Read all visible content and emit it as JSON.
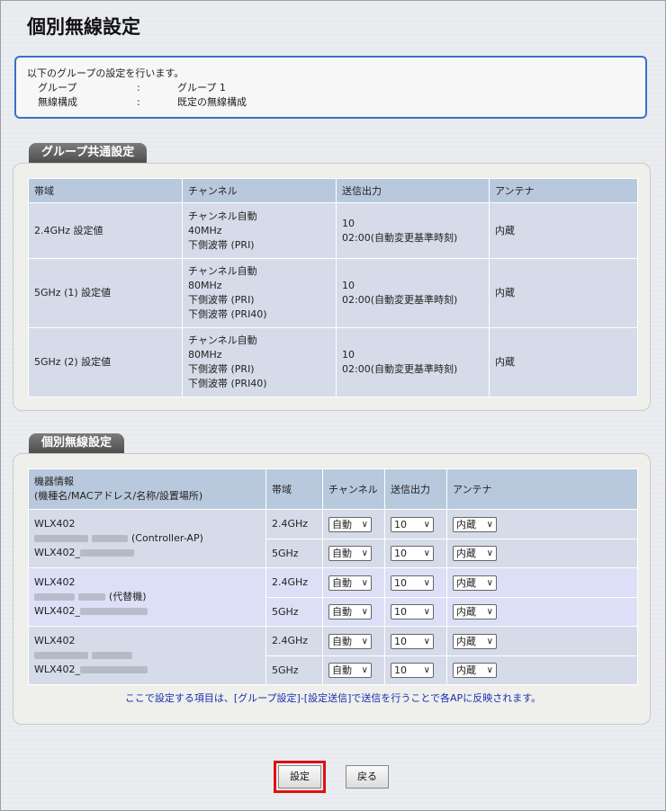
{
  "page": {
    "title": "個別無線設定",
    "info": {
      "intro": "以下のグループの設定を行います。",
      "rows": [
        {
          "key": "グループ",
          "colon": ":",
          "value": "グループ 1"
        },
        {
          "key": "無線構成",
          "colon": ":",
          "value": "既定の無線構成"
        }
      ]
    }
  },
  "common": {
    "tab_label": "グループ共通設定",
    "headers": [
      "帯域",
      "チャンネル",
      "送信出力",
      "アンテナ"
    ],
    "rows": [
      {
        "band": "2.4GHz 設定値",
        "channel": [
          "チャンネル自動",
          "40MHz",
          "下側波帯 (PRI)"
        ],
        "power": [
          "10",
          "02:00(自動変更基準時刻)"
        ],
        "antenna": "内蔵"
      },
      {
        "band": "5GHz (1) 設定値",
        "channel": [
          "チャンネル自動",
          "80MHz",
          "下側波帯 (PRI)",
          "下側波帯 (PRI40)"
        ],
        "power": [
          "10",
          "02:00(自動変更基準時刻)"
        ],
        "antenna": "内蔵"
      },
      {
        "band": "5GHz (2) 設定値",
        "channel": [
          "チャンネル自動",
          "80MHz",
          "下側波帯 (PRI)",
          "下側波帯 (PRI40)"
        ],
        "power": [
          "10",
          "02:00(自動変更基準時刻)"
        ],
        "antenna": "内蔵"
      }
    ]
  },
  "individual": {
    "tab_label": "個別無線設定",
    "headers": {
      "device_line1": "機器情報",
      "device_line2": "(機種名/MACアドレス/名称/設置場所)",
      "band": "帯域",
      "channel": "チャンネル",
      "power": "送信出力",
      "antenna": "アンテナ"
    },
    "devices": [
      {
        "model": "WLX402",
        "name_suffix": "(Controller-AP)",
        "loc_prefix": "WLX402_",
        "bands": [
          {
            "band": "2.4GHz",
            "channel": "自動",
            "power": "10",
            "antenna": "内蔵"
          },
          {
            "band": "5GHz",
            "channel": "自動",
            "power": "10",
            "antenna": "内蔵"
          }
        ]
      },
      {
        "model": "WLX402",
        "name_suffix": "(代替機)",
        "loc_prefix": "WLX402_",
        "bands": [
          {
            "band": "2.4GHz",
            "channel": "自動",
            "power": "10",
            "antenna": "内蔵"
          },
          {
            "band": "5GHz",
            "channel": "自動",
            "power": "10",
            "antenna": "内蔵"
          }
        ]
      },
      {
        "model": "WLX402",
        "name_suffix": "",
        "loc_prefix": "WLX402_",
        "bands": [
          {
            "band": "2.4GHz",
            "channel": "自動",
            "power": "10",
            "antenna": "内蔵"
          },
          {
            "band": "5GHz",
            "channel": "自動",
            "power": "10",
            "antenna": "内蔵"
          }
        ]
      }
    ],
    "note": "ここで設定する項目は、[グループ設定]-[設定送信]で送信を行うことで各APに反映されます。"
  },
  "buttons": {
    "submit": "設定",
    "back": "戻る"
  },
  "colors": {
    "accent_border": "#3a6fc9",
    "highlight_red": "#e01010",
    "header_bg": "#b9c9dd"
  }
}
